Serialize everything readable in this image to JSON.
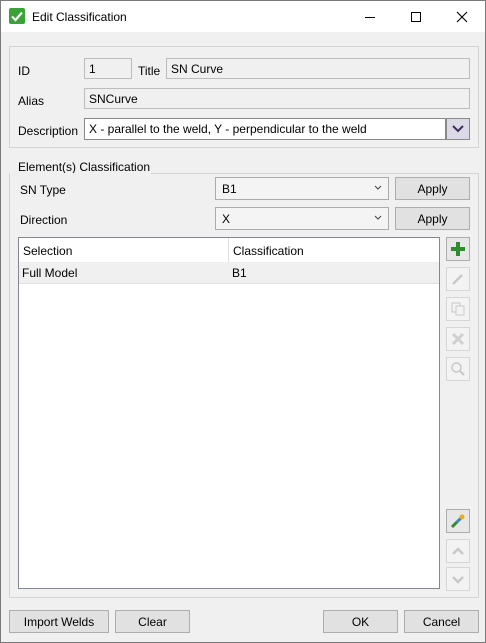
{
  "window": {
    "title": "Edit Classification"
  },
  "general": {
    "id_label": "ID",
    "id_value": "1",
    "title_label": "Title",
    "title_value": "SN Curve",
    "alias_label": "Alias",
    "alias_value": "SNCurve",
    "description_label": "Description",
    "description_value": "X - parallel to the weld, Y - perpendicular to the weld"
  },
  "classification": {
    "group_label": "Element(s) Classification",
    "sn_type_label": "SN Type",
    "sn_type_value": "B1",
    "direction_label": "Direction",
    "direction_value": "X",
    "apply_label": "Apply",
    "table": {
      "columns": [
        "Selection",
        "Classification"
      ],
      "rows": [
        [
          "Full Model",
          "B1"
        ]
      ]
    }
  },
  "footer": {
    "import_label": "Import Welds",
    "clear_label": "Clear",
    "ok_label": "OK",
    "cancel_label": "Cancel"
  },
  "icons": {
    "app": "green-check-icon",
    "add": "plus-icon",
    "edit": "pencil-icon",
    "copy": "copy-icon",
    "delete": "delete-icon",
    "find": "magnifier-icon",
    "pick": "pick-elements-icon",
    "up": "chevron-up-icon",
    "down": "chevron-down-icon"
  },
  "colors": {
    "accent_green": "#3aa335",
    "dropdown_button": "#dcd9e6"
  }
}
